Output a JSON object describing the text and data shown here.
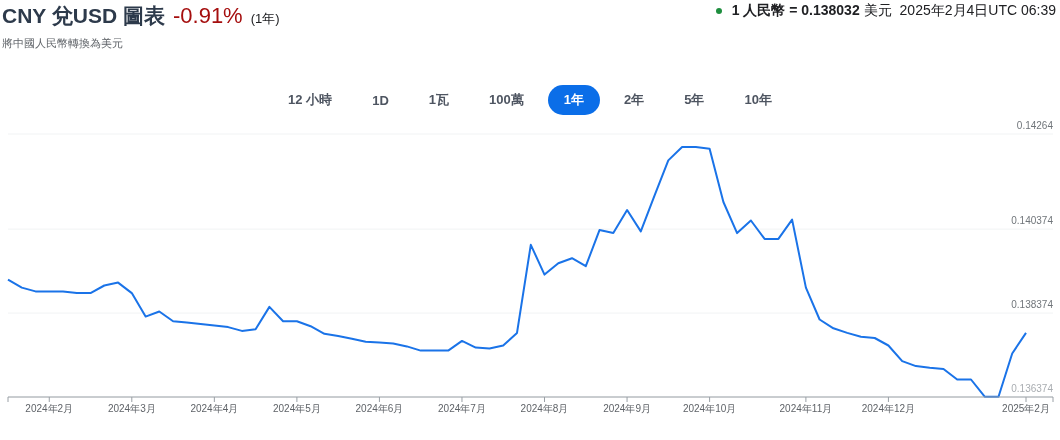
{
  "header": {
    "title": "CNY 兌USD 圖表",
    "change": "-0.91%",
    "period": "(1年)",
    "subtitle": "將中國人民幣轉換為美元",
    "rate": "**1 人民幣 = 0.138032** 美元",
    "timestamp": "2025年2月4日UTC 06:39"
  },
  "ranges": [
    {
      "label": "12 小時",
      "selected": false
    },
    {
      "label": "1D",
      "selected": false
    },
    {
      "label": "1瓦",
      "selected": false
    },
    {
      "label": "100萬",
      "selected": false
    },
    {
      "label": "1年",
      "selected": true
    },
    {
      "label": "2年",
      "selected": false
    },
    {
      "label": "5年",
      "selected": false
    },
    {
      "label": "10年",
      "selected": false
    }
  ],
  "chart": {
    "chart_data": {
      "type": "line",
      "categories": [
        null,
        null,
        null,
        "2024年2月",
        null,
        null,
        null,
        null,
        null,
        "2024年3月",
        null,
        null,
        null,
        null,
        null,
        "2024年4月",
        null,
        null,
        null,
        null,
        null,
        "2024年5月",
        null,
        null,
        null,
        null,
        null,
        "2024年6月",
        null,
        null,
        null,
        null,
        null,
        "2024年7月",
        null,
        null,
        null,
        null,
        null,
        "2024年8月",
        null,
        null,
        null,
        null,
        null,
        "2024年9月",
        null,
        null,
        null,
        null,
        null,
        "2024年10月",
        null,
        null,
        null,
        null,
        null,
        null,
        "2024年11月",
        null,
        null,
        null,
        null,
        null,
        "2024年12月",
        null,
        null,
        null,
        null,
        null,
        null,
        null,
        null,
        null,
        "2025年2月"
      ],
      "series": [
        {
          "color": "#1a73e8",
          "values": [
            0.13917,
            0.13898,
            0.13889,
            0.13889,
            0.13889,
            0.13885,
            0.13885,
            0.13903,
            0.1391,
            0.13885,
            0.13829,
            0.13841,
            0.13818,
            0.13815,
            0.13811,
            0.13808,
            0.13804,
            0.13795,
            0.13799,
            0.13852,
            0.13818,
            0.13818,
            0.13806,
            0.13788,
            0.13783,
            0.13776,
            0.13769,
            0.13767,
            0.13765,
            0.13758,
            0.13748,
            0.13748,
            0.13748,
            0.13771,
            0.13755,
            0.13753,
            0.1376,
            0.1379,
            0.14,
            0.13929,
            0.13956,
            0.13968,
            0.13949,
            0.14035,
            0.14028,
            0.14083,
            0.14032,
            0.14118,
            0.14201,
            0.14233,
            0.14233,
            0.14229,
            0.14102,
            0.14028,
            0.14058,
            0.14014,
            0.14014,
            0.1406,
            0.13898,
            0.13822,
            0.13801,
            0.1379,
            0.13781,
            0.13778,
            0.1376,
            0.13723,
            0.13711,
            0.13707,
            0.13704,
            0.13679,
            0.13679,
            0.13638,
            0.13638,
            0.13741,
            0.1379
          ]
        }
      ],
      "ylim": [
        0.136374,
        0.14264
      ],
      "yticks": [
        0.14264,
        0.140374,
        0.138374,
        0.136374
      ]
    }
  }
}
